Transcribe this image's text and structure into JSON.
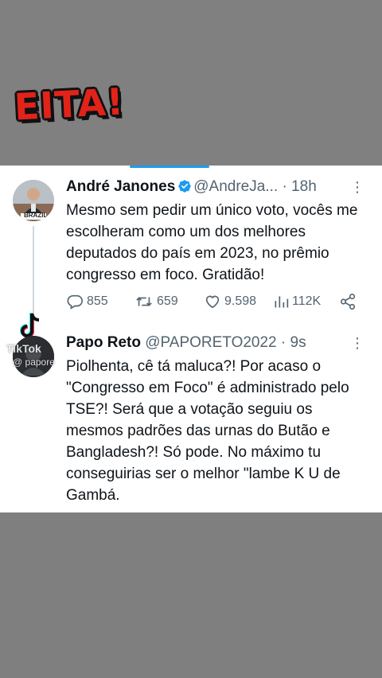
{
  "sticker": {
    "text": "EITA!"
  },
  "tweet1": {
    "name": "André Janones",
    "handle": "@AndreJa...",
    "time": "· 18h",
    "text": "Mesmo sem pedir um único voto, vocês me escolheram como um dos melhores deputados do país em 2023, no prêmio congresso em foco. Gratidão!",
    "avatar_label": "BRAZIL",
    "replies": "855",
    "retweets": "659",
    "likes": "9.598",
    "views": "112K"
  },
  "tweet2": {
    "name": "Papo Reto",
    "handle": "@PAPORETO2022",
    "time": "· 9s",
    "text": "Piolhenta, cê tá maluca?! Por acaso o \"Congresso em Foco\" é administrado pelo TSE?! Será que a votação seguiu os mesmos padrões das urnas do Butão e Bangladesh?! Só pode. No máximo tu conseguirias ser o melhor \"lambe K U de Gambá."
  },
  "watermark": {
    "brand": "TikTok",
    "user": "@ papore"
  },
  "colors": {
    "accent": "#1d9bf0",
    "sticker_red": "#e2231a",
    "text": "#0f1419",
    "muted": "#536471"
  },
  "icons": [
    "verified-badge-icon",
    "more-icon",
    "reply-icon",
    "retweet-icon",
    "like-icon",
    "views-icon",
    "share-icon",
    "tiktok-logo-icon"
  ]
}
